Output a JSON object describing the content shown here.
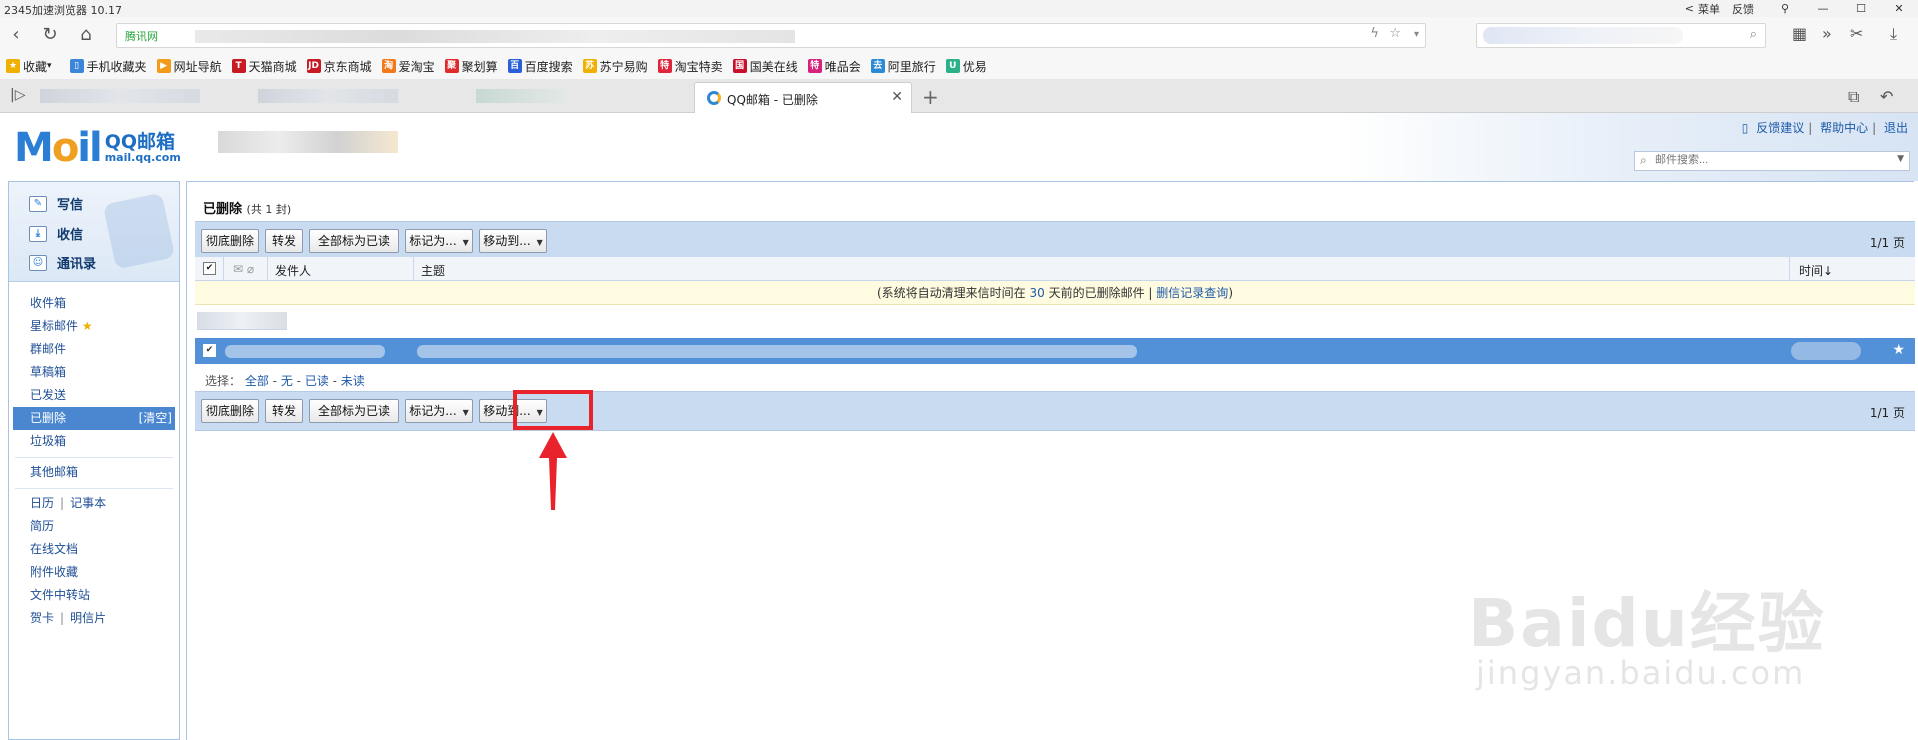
{
  "browser": {
    "title": "2345加速浏览器 10.17",
    "menu_label": "菜单",
    "feedback_label": "反馈",
    "secure_label": "腾讯网",
    "tab_title": "QQ邮箱 - 已删除",
    "bookmarks": [
      {
        "label": "收藏",
        "color": "#f0b000",
        "glyph": "★"
      },
      {
        "label": "手机收藏夹",
        "color": "#3b86d9",
        "glyph": "▯"
      },
      {
        "label": "网址导航",
        "color": "#f29a1a",
        "glyph": "▶"
      },
      {
        "label": "天猫商城",
        "color": "#c81a23",
        "glyph": "T"
      },
      {
        "label": "京东商城",
        "color": "#c81a23",
        "glyph": "JD"
      },
      {
        "label": "爱淘宝",
        "color": "#f27a1a",
        "glyph": "淘"
      },
      {
        "label": "聚划算",
        "color": "#e02b2b",
        "glyph": "聚"
      },
      {
        "label": "百度搜索",
        "color": "#2b5fd6",
        "glyph": "百"
      },
      {
        "label": "苏宁易购",
        "color": "#f0b000",
        "glyph": "苏"
      },
      {
        "label": "淘宝特卖",
        "color": "#e0253b",
        "glyph": "特"
      },
      {
        "label": "国美在线",
        "color": "#c8102e",
        "glyph": "国"
      },
      {
        "label": "唯品会",
        "color": "#d6207a",
        "glyph": "特"
      },
      {
        "label": "阿里旅行",
        "color": "#2b8ad6",
        "glyph": "去"
      },
      {
        "label": "优易",
        "color": "#2bb08a",
        "glyph": "U"
      }
    ]
  },
  "mail": {
    "logo_m": "M",
    "logo_o": "o",
    "logo_il": "il",
    "logo_name": "QQ邮箱",
    "logo_domain": "mail.qq.com",
    "top_links": [
      "反馈建议",
      "帮助中心",
      "退出"
    ],
    "search_placeholder": "邮件搜索...",
    "sidebar": {
      "compose": "写信",
      "inbox_action": "收信",
      "contacts": "通讯录",
      "folders": [
        "收件箱",
        "星标邮件",
        "群邮件",
        "草稿箱",
        "已发送",
        "已删除",
        "垃圾箱"
      ],
      "clear_label": "[清空]",
      "other": "其他邮箱",
      "calendar": "日历",
      "notebook": "记事本",
      "resume": "简历",
      "docs": "在线文档",
      "attachments": "附件收藏",
      "transfer": "文件中转站",
      "greeting": "贺卡",
      "postcard": "明信片"
    },
    "folder_title": "已删除",
    "folder_count": "(共 1 封)",
    "toolbar": {
      "delete_forever": "彻底删除",
      "forward": "转发",
      "mark_all_read": "全部标为已读",
      "mark_as": "标记为...",
      "move_to": "移动到..."
    },
    "pager": "1/1 页",
    "columns": {
      "sender": "发件人",
      "subject": "主题",
      "time": "时间↓"
    },
    "notice_prefix": "(系统将自动清理来信时间在",
    "notice_days": "30",
    "notice_suffix": "天前的已删除邮件 |",
    "notice_link": "删信记录查询",
    "notice_end": ")",
    "select_prefix": "选择：",
    "select_options": [
      "全部",
      "无",
      "已读",
      "未读"
    ]
  },
  "watermark": {
    "big": "Baidu经验",
    "small": "jingyan.baidu.com"
  },
  "colors": {
    "highlight": "#e8232b",
    "accent": "#4a87d0",
    "toolbar": "#c9dbf0"
  }
}
